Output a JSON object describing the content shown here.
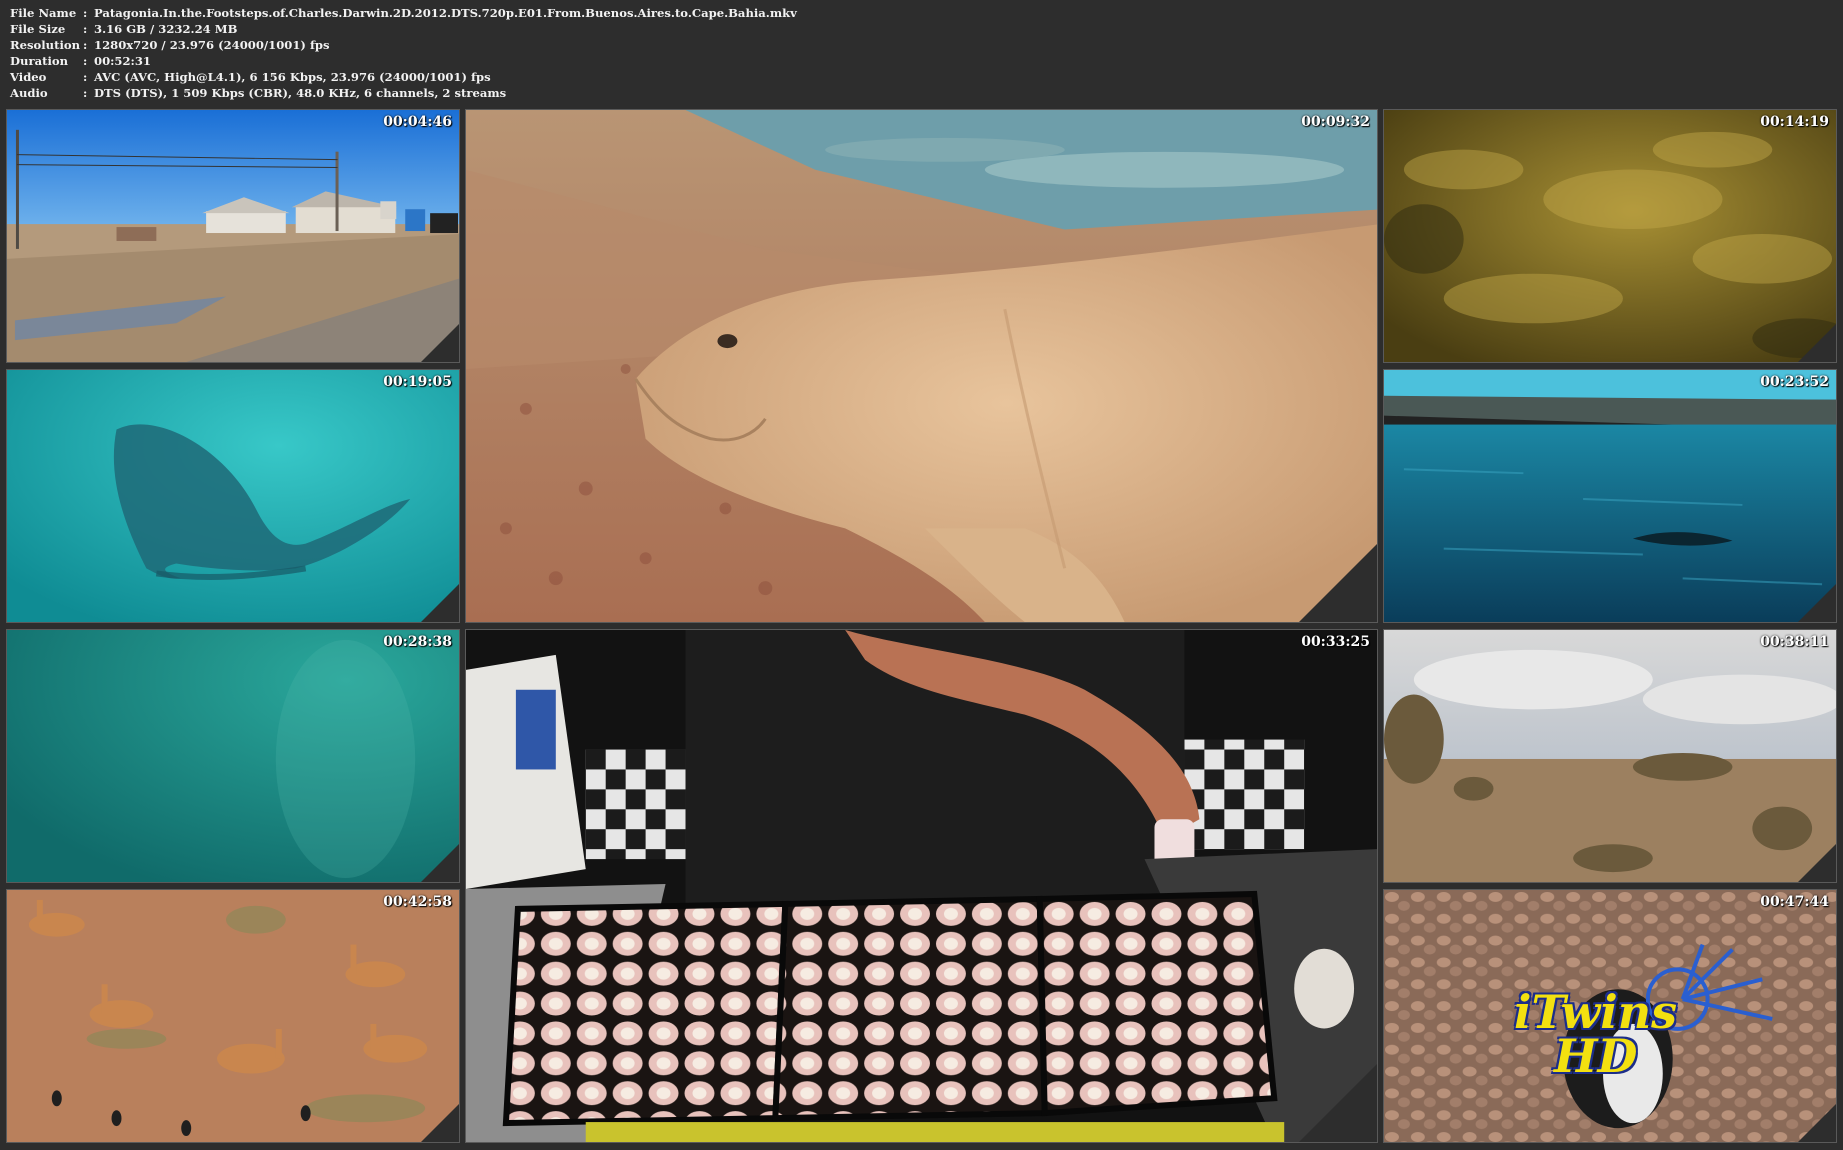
{
  "info": {
    "rows": [
      {
        "label": "File Name",
        "value": "Patagonia.In.the.Footsteps.of.Charles.Darwin.2D.2012.DTS.720p.E01.From.Buenos.Aires.to.Cape.Bahia.mkv"
      },
      {
        "label": "File Size",
        "value": "3.16 GB  / 3232.24 MB"
      },
      {
        "label": "Resolution",
        "value": "1280x720 / 23.976 (24000/1001) fps"
      },
      {
        "label": "Duration",
        "value": "00:52:31"
      },
      {
        "label": "Video",
        "value": "AVC (AVC, High@L4.1), 6 156 Kbps, 23.976 (24000/1001) fps"
      },
      {
        "label": "Audio",
        "value": "DTS (DTS), 1 509 Kbps (CBR), 48.0 KHz, 6 channels, 2 streams"
      }
    ],
    "separator": ":"
  },
  "thumbnails": [
    {
      "timestamp": "00:04:46",
      "scene": "village-road"
    },
    {
      "timestamp": "00:09:32",
      "scene": "elephant-seal"
    },
    {
      "timestamp": "00:14:19",
      "scene": "seaweed"
    },
    {
      "timestamp": "00:19:05",
      "scene": "whale-underwater"
    },
    {
      "timestamp": "00:23:52",
      "scene": "sea-cliffs"
    },
    {
      "timestamp": "00:28:38",
      "scene": "underwater-green"
    },
    {
      "timestamp": "00:33:25",
      "scene": "scallops-kitchen"
    },
    {
      "timestamp": "00:38:11",
      "scene": "scrubland"
    },
    {
      "timestamp": "00:42:58",
      "scene": "guanacos"
    },
    {
      "timestamp": "00:47:44",
      "scene": "penguin-pebbles"
    }
  ],
  "watermark": {
    "line1": "iTwins",
    "line2": "HD"
  },
  "colors": {
    "background": "#2d2d2d",
    "text": "#ffffff",
    "logo_yellow": "#f3e010",
    "logo_blue": "#1c2e8a"
  }
}
